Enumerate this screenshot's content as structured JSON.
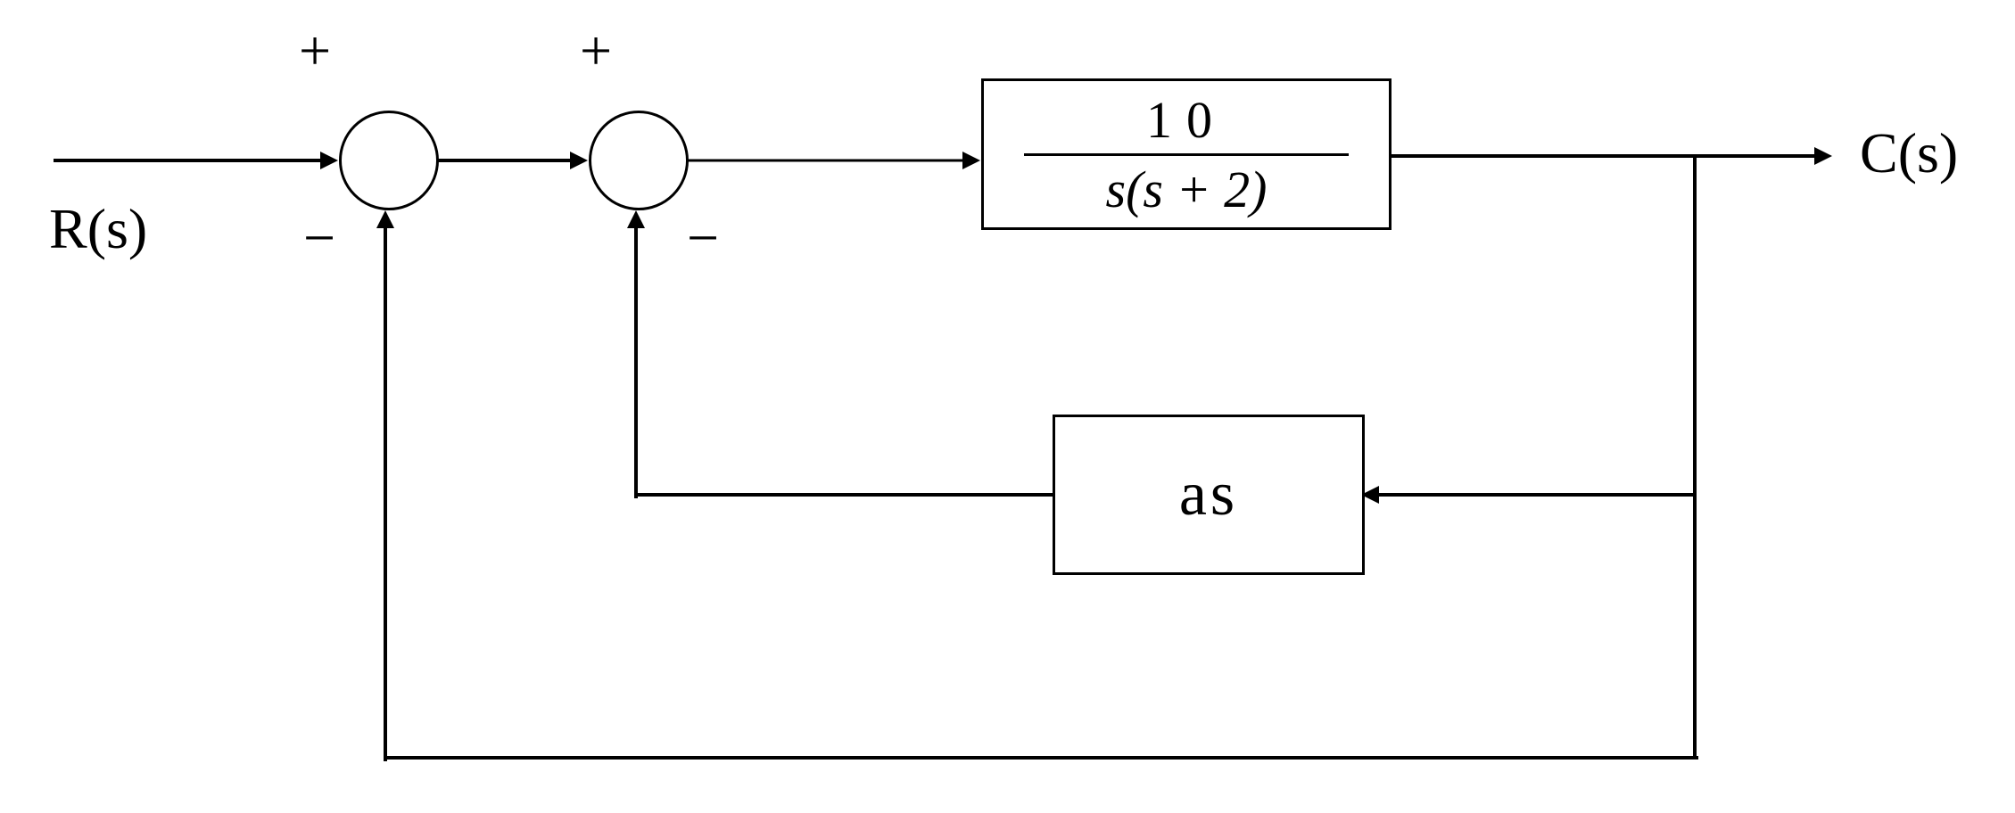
{
  "input_label": "R(s)",
  "output_label": "C(s)",
  "sum1": {
    "plus_sign": "+",
    "minus_sign": "−"
  },
  "sum2": {
    "plus_sign": "+",
    "minus_sign": "−"
  },
  "forward_block": {
    "numerator": "10",
    "denominator": "s(s + 2)"
  },
  "inner_feedback_block": {
    "label": "as"
  },
  "outer_feedback_gain": 1,
  "chart_data": {
    "type": "block_diagram",
    "input": "R(s)",
    "output": "C(s)",
    "forward_path_transfer_function": "10 / (s(s+2))",
    "inner_loop_feedback": "as",
    "outer_loop_feedback": "1 (unity)",
    "summing_junctions": [
      {
        "inputs": [
          "+R(s)",
          "-C(s)"
        ],
        "position": "first"
      },
      {
        "inputs": [
          "+sum1_out",
          "-as*C(s)"
        ],
        "position": "second"
      }
    ]
  }
}
